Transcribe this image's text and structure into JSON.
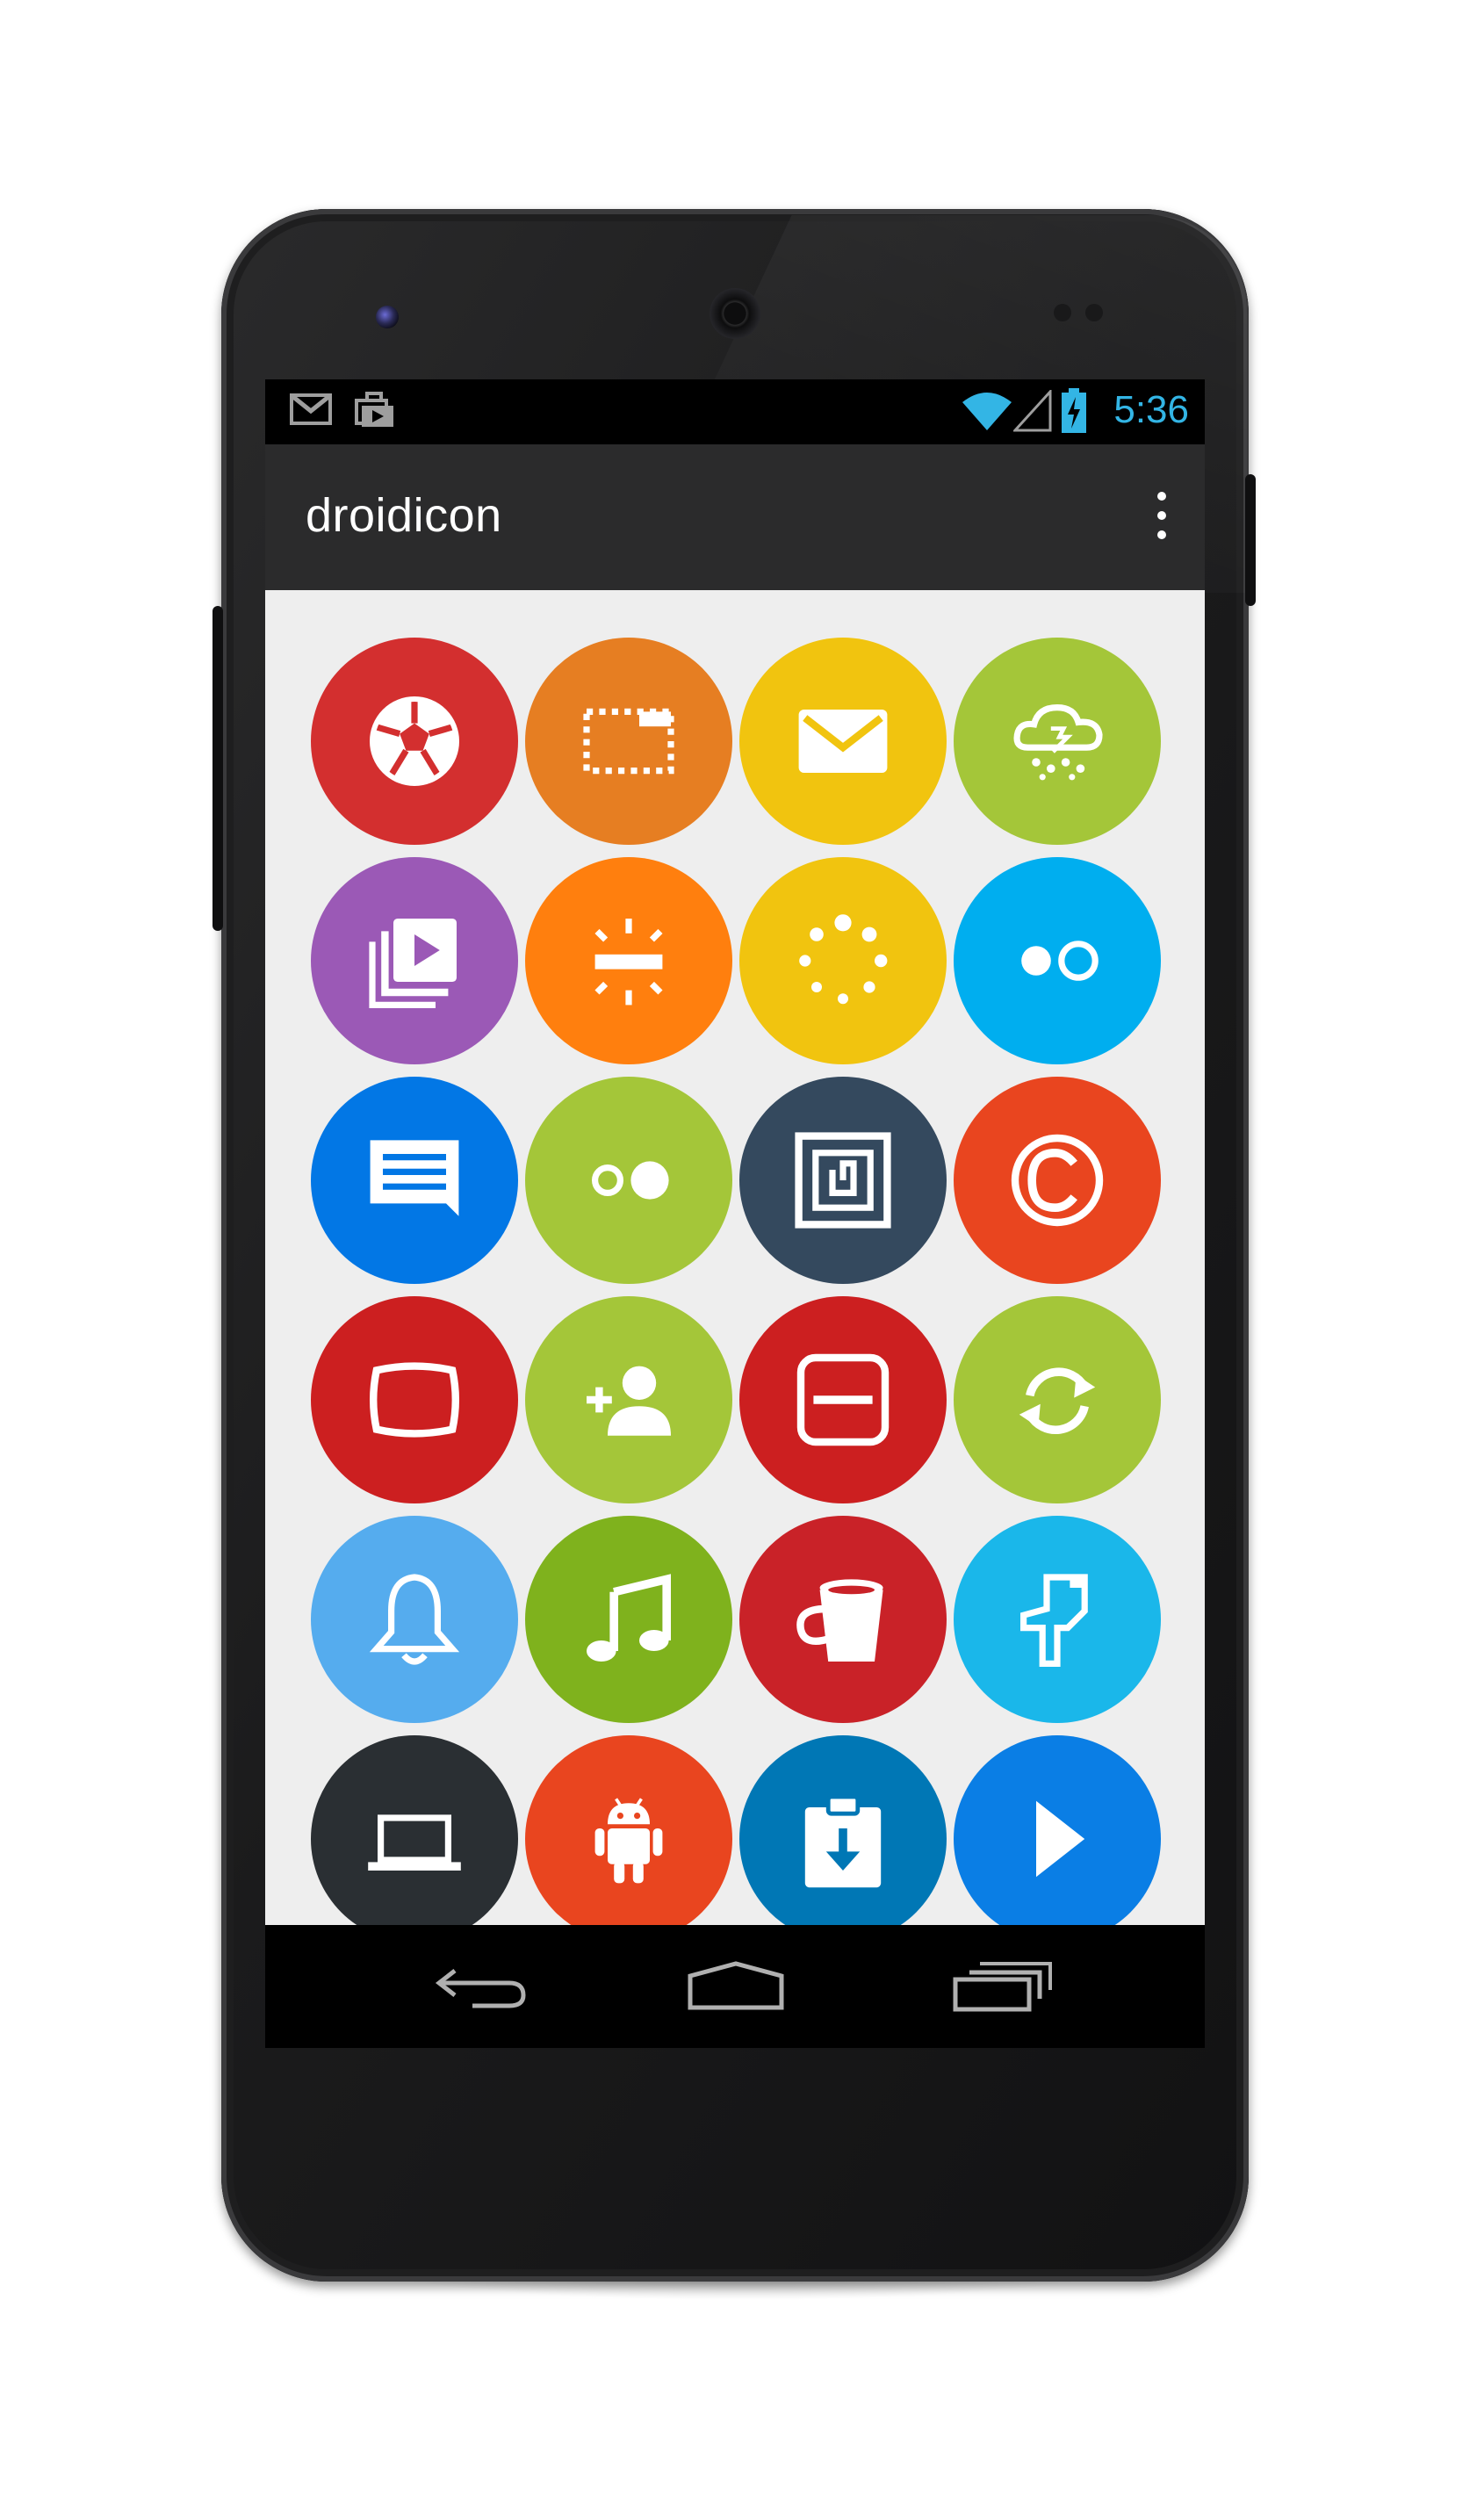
{
  "status_bar": {
    "time": "5:36",
    "left_icons": [
      "gmail-icon",
      "play-store-update-icon"
    ],
    "right_icons": [
      "wifi-icon",
      "cell-signal-icon",
      "battery-charging-icon"
    ],
    "time_color": "#33b5e5"
  },
  "action_bar": {
    "title": "droidicon",
    "overflow_icon": "overflow-menu-icon"
  },
  "icons": [
    {
      "name": "soccer-ball-icon",
      "color": "#d32f2f"
    },
    {
      "name": "crop-frame-icon",
      "color": "#e67e22"
    },
    {
      "name": "mail-envelope-icon",
      "color": "#f1c40f"
    },
    {
      "name": "weather-rain-icon",
      "color": "#a4c639"
    },
    {
      "name": "video-library-icon",
      "color": "#9b59b6"
    },
    {
      "name": "brightness-icon",
      "color": "#ff7f0e"
    },
    {
      "name": "loading-spinner-icon",
      "color": "#f1c40f"
    },
    {
      "name": "flickr-icon",
      "color": "#00aeef"
    },
    {
      "name": "chat-message-icon",
      "color": "#0277e5"
    },
    {
      "name": "flickr-alt-icon",
      "color": "#a4c639"
    },
    {
      "name": "nfc-icon",
      "color": "#34495e"
    },
    {
      "name": "copyright-icon",
      "color": "#e9451f"
    },
    {
      "name": "tv-screen-icon",
      "color": "#cc1f20"
    },
    {
      "name": "add-person-icon",
      "color": "#a4c639"
    },
    {
      "name": "remove-box-icon",
      "color": "#cc1f20"
    },
    {
      "name": "sync-icon",
      "color": "#a4c639"
    },
    {
      "name": "notification-bell-icon",
      "color": "#55acee"
    },
    {
      "name": "music-note-icon",
      "color": "#7fb21d"
    },
    {
      "name": "paint-bucket-icon",
      "color": "#c92228"
    },
    {
      "name": "hand-pointer-icon",
      "color": "#1ab7ea"
    },
    {
      "name": "laptop-icon",
      "color": "#2a2f33"
    },
    {
      "name": "android-robot-icon",
      "color": "#e9451f"
    },
    {
      "name": "download-clipboard-icon",
      "color": "#0077b5"
    },
    {
      "name": "play-arrow-icon",
      "color": "#0a7ee5"
    }
  ],
  "nav_bar": {
    "back": "back-arrow-icon",
    "home": "home-icon",
    "recents": "recent-apps-icon"
  }
}
